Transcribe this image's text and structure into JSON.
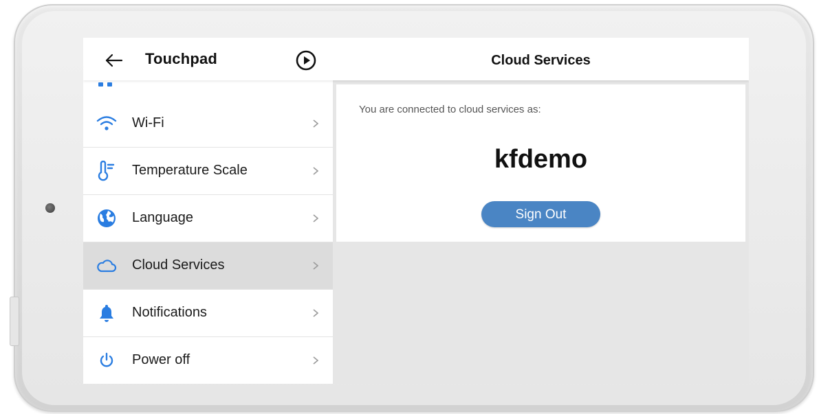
{
  "header": {
    "app_title": "Touchpad",
    "detail_title": "Cloud Services"
  },
  "sidebar": {
    "items": [
      {
        "label": "Wi-Fi",
        "icon": "wifi-icon"
      },
      {
        "label": "Temperature Scale",
        "icon": "thermometer-icon"
      },
      {
        "label": "Language",
        "icon": "globe-icon"
      },
      {
        "label": "Cloud Services",
        "icon": "cloud-icon",
        "selected": true
      },
      {
        "label": "Notifications",
        "icon": "bell-icon"
      },
      {
        "label": "Power off",
        "icon": "power-icon"
      }
    ]
  },
  "cloud": {
    "connected_text": "You are connected to cloud services as:",
    "username": "kfdemo",
    "sign_out_label": "Sign Out"
  },
  "colors": {
    "accent": "#2a7de1",
    "button": "#4a85c4",
    "selected_row": "#dcdcdc",
    "panel_bg": "#e6e6e6"
  }
}
